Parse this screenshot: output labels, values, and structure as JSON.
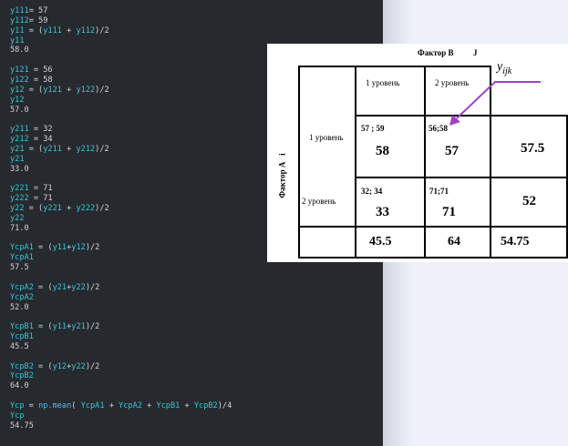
{
  "editor": {
    "lines": [
      {
        "t": "y111= 57"
      },
      {
        "t": "y112= 59"
      },
      {
        "t": "y11 = (y111 + y112)/2"
      },
      {
        "t": "y11"
      },
      {
        "t": "58.0",
        "out": true
      },
      {
        "t": ""
      },
      {
        "t": "y121 = 56"
      },
      {
        "t": "y122 = 58"
      },
      {
        "t": "y12 = (y121 + y122)/2"
      },
      {
        "t": "y12"
      },
      {
        "t": "57.0",
        "out": true
      },
      {
        "t": ""
      },
      {
        "t": "y211 = 32"
      },
      {
        "t": "y212 = 34"
      },
      {
        "t": "y21 = (y211 + y212)/2"
      },
      {
        "t": "y21"
      },
      {
        "t": "33.0",
        "out": true
      },
      {
        "t": ""
      },
      {
        "t": "y221 = 71"
      },
      {
        "t": "y222 = 71"
      },
      {
        "t": "y22 = (y221 + y222)/2"
      },
      {
        "t": "y22"
      },
      {
        "t": "71.0",
        "out": true
      },
      {
        "t": ""
      },
      {
        "t": "YcpA1 = (y11+y12)/2"
      },
      {
        "t": "YcpA1"
      },
      {
        "t": "57.5",
        "out": true
      },
      {
        "t": ""
      },
      {
        "t": "YcpA2 = (y21+y22)/2"
      },
      {
        "t": "YcpA2"
      },
      {
        "t": "52.0",
        "out": true
      },
      {
        "t": ""
      },
      {
        "t": "YcpB1 = (y11+y21)/2"
      },
      {
        "t": "YcpB1"
      },
      {
        "t": "45.5",
        "out": true
      },
      {
        "t": ""
      },
      {
        "t": "YcpB2 = (y12+y22)/2"
      },
      {
        "t": "YcpB2"
      },
      {
        "t": "64.0",
        "out": true
      },
      {
        "t": ""
      },
      {
        "t": "Ycp = np.mean( YcpA1 + YcpA2 + YcpB1 + YcpB2)/4"
      },
      {
        "t": "Ycp"
      },
      {
        "t": "54.75",
        "out": true
      }
    ]
  },
  "table": {
    "factor_b": "Фактор B",
    "factor_b_index": "J",
    "factor_a": "Фактор A",
    "factor_a_index": "i",
    "annotation": "y",
    "annotation_sub": "ijk",
    "col1_header": "1 уровень",
    "col2_header": "2 уровень",
    "row1_header": "1 уровень",
    "row2_header": "2 уровень",
    "c11_obs": "57 ; 59",
    "c11_mean": "58",
    "c12_obs": "56;58",
    "c12_mean": "57",
    "row1_mean": "57.5",
    "c21_obs": "32; 34",
    "c21_mean": "33",
    "c22_obs": "71;71",
    "c22_mean": "71",
    "row2_mean": "52",
    "col1_mean": "45.5",
    "col2_mean": "64",
    "grand_mean": "54.75"
  },
  "colors": {
    "editor_bg": "#262a2e",
    "variable": "#34c6d8",
    "arrow": "#a040c8"
  }
}
